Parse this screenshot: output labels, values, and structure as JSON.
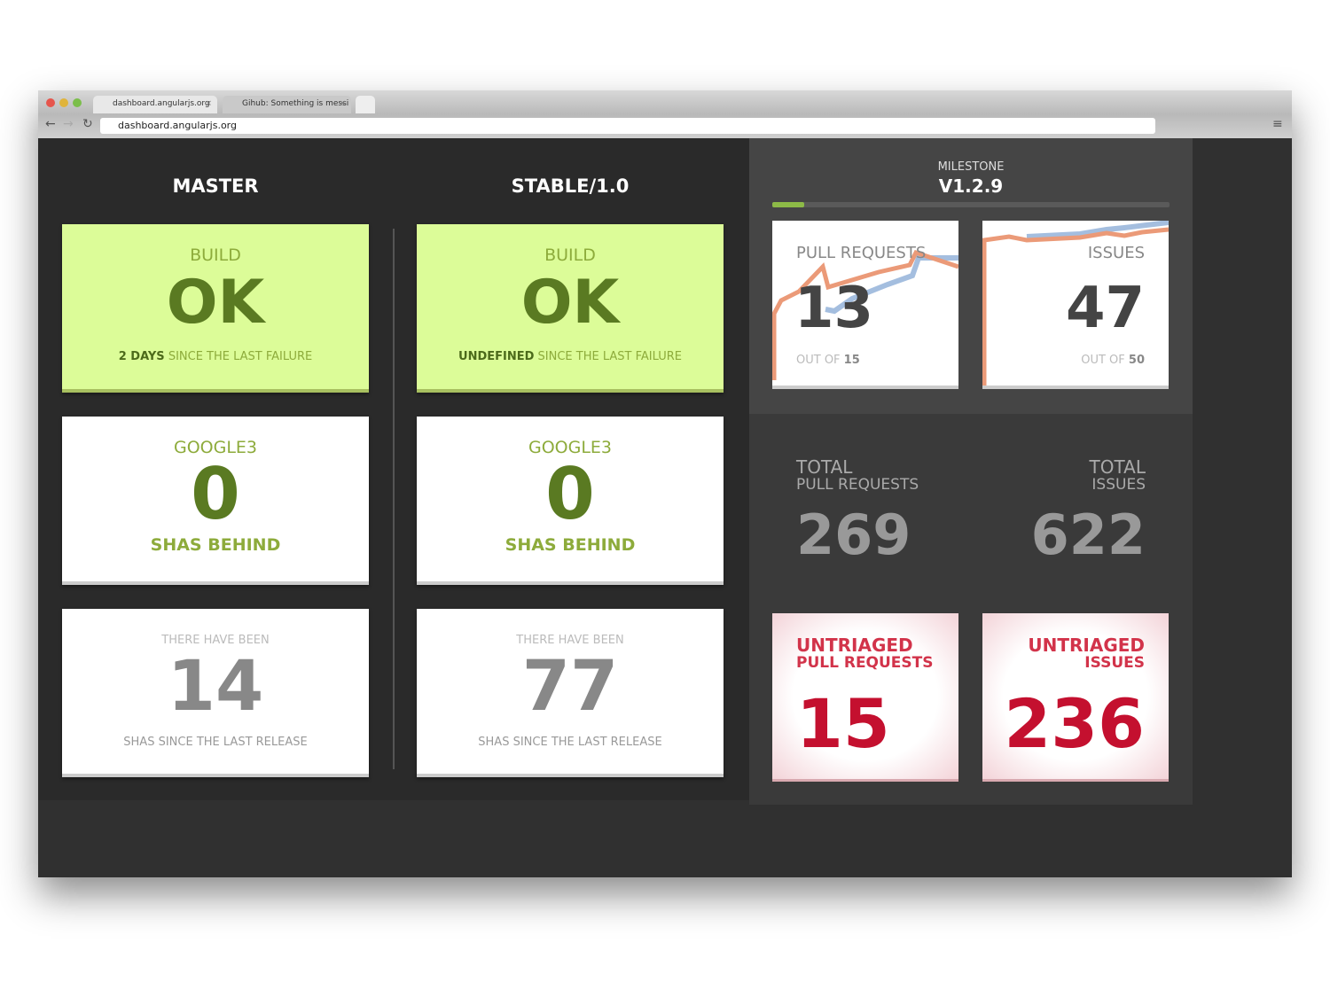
{
  "browser": {
    "tabs": [
      {
        "title": "dashboard.angularjs.org"
      },
      {
        "title": "Gihub: Something is messi"
      }
    ],
    "url": "dashboard.angularjs.org"
  },
  "columns": [
    {
      "title": "MASTER",
      "build": {
        "label": "BUILD",
        "status": "OK",
        "since_value": "2 DAYS",
        "since_text": "SINCE THE LAST FAILURE"
      },
      "google3": {
        "label": "GOOGLE3",
        "value": "0",
        "sub": "SHAS BEHIND"
      },
      "release": {
        "label": "THERE HAVE BEEN",
        "value": "14",
        "sub": "SHAS SINCE THE LAST RELEASE"
      }
    },
    {
      "title": "STABLE/1.0",
      "build": {
        "label": "BUILD",
        "status": "OK",
        "since_value": "UNDEFINED",
        "since_text": "SINCE THE LAST FAILURE"
      },
      "google3": {
        "label": "GOOGLE3",
        "value": "0",
        "sub": "SHAS BEHIND"
      },
      "release": {
        "label": "THERE HAVE BEEN",
        "value": "77",
        "sub": "SHAS SINCE THE LAST RELEASE"
      }
    }
  ],
  "milestone": {
    "label": "MILESTONE",
    "version": "V1.2.9",
    "progress_percent": 8,
    "pull_requests": {
      "label": "PULL REQUESTS",
      "value": "13",
      "out_of_label": "OUT OF",
      "out_of": "15"
    },
    "issues": {
      "label": "ISSUES",
      "value": "47",
      "out_of_label": "OUT OF",
      "out_of": "50"
    }
  },
  "totals": {
    "prs": {
      "line1": "TOTAL",
      "line2": "PULL REQUESTS",
      "value": "269"
    },
    "issues": {
      "line1": "TOTAL",
      "line2": "ISSUES",
      "value": "622"
    }
  },
  "untriaged": {
    "prs": {
      "line1": "UNTRIAGED",
      "line2": "PULL REQUESTS",
      "value": "15"
    },
    "issues": {
      "line1": "UNTRIAGED",
      "line2": "ISSUES",
      "value": "236"
    }
  },
  "colors": {
    "build_ok": "#dcfc98",
    "accent_green": "#8dab3b",
    "untriaged_red": "#c4102f",
    "spark_orange": "#eb9a78",
    "spark_blue": "#a4bedf"
  }
}
